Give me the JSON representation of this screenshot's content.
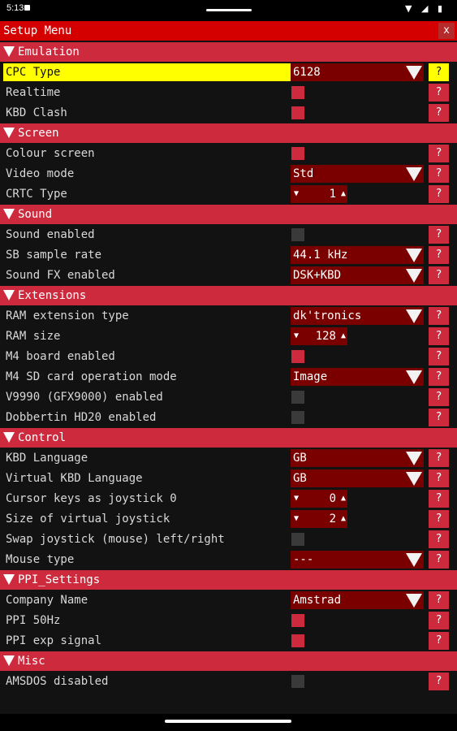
{
  "status_bar": {
    "time": "5:13",
    "icons": "▼ ◢ ▮"
  },
  "window": {
    "title": "Setup Menu",
    "close_label": "x"
  },
  "help_label": "?",
  "sections": {
    "emulation": "Emulation",
    "screen": "Screen",
    "sound": "Sound",
    "extensions": "Extensions",
    "control": "Control",
    "ppi": "PPI_Settings",
    "misc": "Misc"
  },
  "emulation": {
    "cpc_type": {
      "label": "CPC Type",
      "value": "6128"
    },
    "realtime": {
      "label": "Realtime",
      "checked": true
    },
    "kbd_clash": {
      "label": "KBD Clash",
      "checked": true
    }
  },
  "screen": {
    "colour_screen": {
      "label": "Colour screen",
      "checked": true
    },
    "video_mode": {
      "label": "Video mode",
      "value": "Std"
    },
    "crtc_type": {
      "label": "CRTC Type",
      "value": "1"
    }
  },
  "sound": {
    "sound_enabled": {
      "label": "Sound enabled",
      "checked": false
    },
    "sb_sample_rate": {
      "label": "SB sample rate",
      "value": "44.1 kHz"
    },
    "sound_fx": {
      "label": "Sound FX enabled",
      "value": "DSK+KBD"
    }
  },
  "extensions": {
    "ram_ext_type": {
      "label": "RAM extension type",
      "value": "dk'tronics"
    },
    "ram_size": {
      "label": "RAM size",
      "value": "128"
    },
    "m4_board": {
      "label": "M4 board enabled",
      "checked": true
    },
    "m4_sd_mode": {
      "label": "M4 SD card operation mode",
      "value": "Image"
    },
    "v9990": {
      "label": "V9990 (GFX9000) enabled",
      "checked": false
    },
    "dobbertin": {
      "label": "Dobbertin HD20 enabled",
      "checked": false
    }
  },
  "control": {
    "kbd_language": {
      "label": "KBD Language",
      "value": "GB"
    },
    "virtual_kbd_language": {
      "label": "Virtual KBD Language",
      "value": "GB"
    },
    "cursor_keys_joystick": {
      "label": "Cursor keys as joystick 0",
      "value": "0"
    },
    "virtual_joystick_size": {
      "label": "Size of virtual joystick",
      "value": "2"
    },
    "swap_joystick": {
      "label": "Swap joystick (mouse) left/right",
      "checked": false
    },
    "mouse_type": {
      "label": "Mouse type",
      "value": "---"
    }
  },
  "ppi": {
    "company_name": {
      "label": "Company Name",
      "value": "Amstrad"
    },
    "ppi_50hz": {
      "label": "PPI 50Hz",
      "checked": true
    },
    "ppi_exp_signal": {
      "label": "PPI exp signal",
      "checked": true
    }
  },
  "misc": {
    "amsdos_disabled": {
      "label": "AMSDOS disabled",
      "checked": false
    }
  },
  "colors": {
    "title_bar": "#d40000",
    "section_header": "#cd2a3e",
    "combo_bg": "#7a0000",
    "highlight": "#ffff00",
    "background": "#121212"
  }
}
